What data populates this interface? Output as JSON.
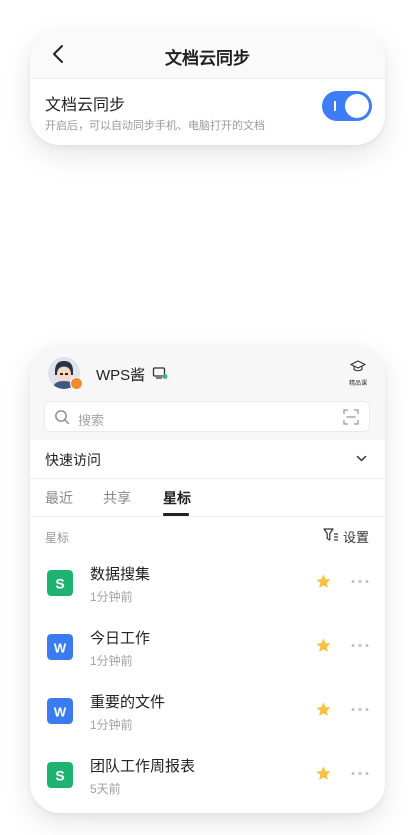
{
  "sync_card": {
    "title": "文档云同步",
    "setting_label": "文档云同步",
    "setting_desc": "开启后，可以自动同步手机、电脑打开的文档",
    "enabled": true,
    "accent": "#3d7df5"
  },
  "home": {
    "username": "WPS酱",
    "class_icon_label": "精品课",
    "search_placeholder": "搜索",
    "quick_access": "快速访问",
    "tabs": [
      "最近",
      "共享",
      "星标"
    ],
    "active_tab": "星标",
    "section_label": "星标",
    "settings_label": "设置",
    "files": [
      {
        "name": "数据搜集",
        "time": "1分钟前",
        "type": "sheet",
        "icon": "S",
        "color": "#1fb271",
        "starred": true
      },
      {
        "name": "今日工作",
        "time": "1分钟前",
        "type": "doc",
        "icon": "W",
        "color": "#3a7cf0",
        "starred": true
      },
      {
        "name": "重要的文件",
        "time": "1分钟前",
        "type": "doc",
        "icon": "W",
        "color": "#3a7cf0",
        "starred": true
      },
      {
        "name": "团队工作周报表",
        "time": "5天前",
        "type": "sheet",
        "icon": "S",
        "color": "#1fb271",
        "starred": true
      }
    ],
    "star_color": "#f5c242"
  }
}
